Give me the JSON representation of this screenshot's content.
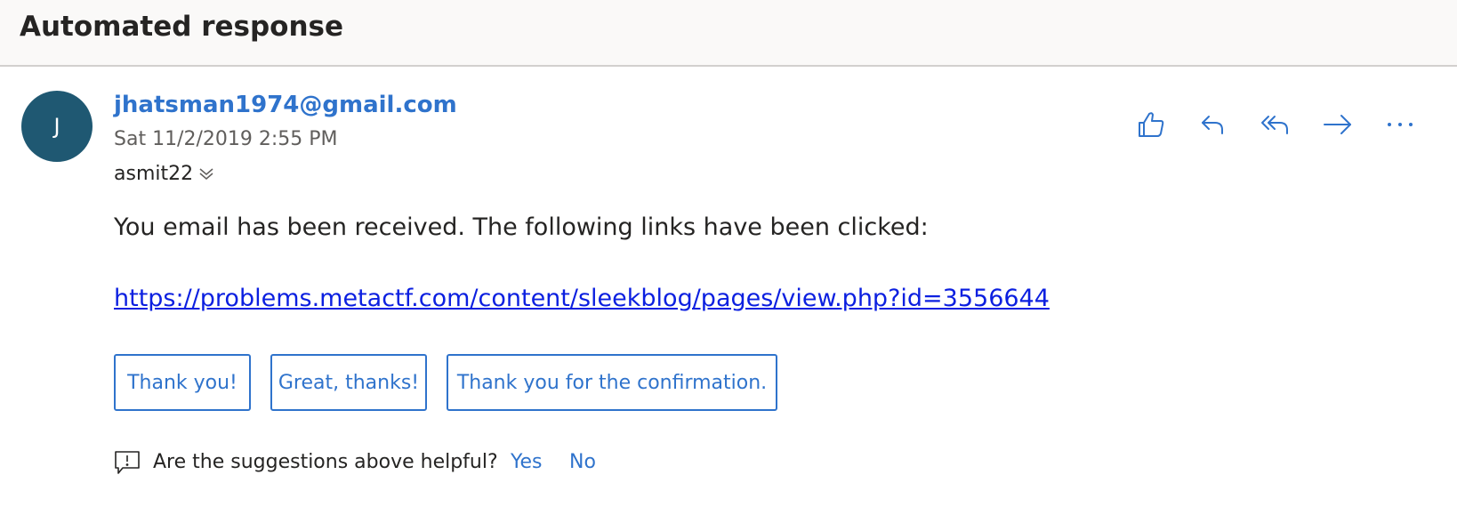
{
  "email": {
    "subject": "Automated response",
    "avatar_initial": "J",
    "sender": "jhatsman1974@gmail.com",
    "datetime": "Sat 11/2/2019 2:55 PM",
    "recipient": "asmit22",
    "body_text": "You email has been received. The following links have been clicked:",
    "link": "https://problems.metactf.com/content/sleekblog/pages/view.php?id=3556644"
  },
  "actions": [
    {
      "name": "like",
      "icon": "thumbs-up-icon"
    },
    {
      "name": "reply",
      "icon": "reply-icon"
    },
    {
      "name": "reply-all",
      "icon": "reply-all-icon"
    },
    {
      "name": "forward",
      "icon": "forward-icon"
    },
    {
      "name": "more",
      "icon": "more-icon"
    }
  ],
  "suggested_replies": [
    "Thank you!",
    "Great, thanks!",
    "Thank you for the confirmation."
  ],
  "feedback": {
    "question": "Are the suggestions above helpful?",
    "yes": "Yes",
    "no": "No"
  },
  "colors": {
    "accent": "#2f73cc",
    "avatar": "#1f5872",
    "link": "#0b1fe0",
    "subject_bar": "#faf9f8"
  }
}
